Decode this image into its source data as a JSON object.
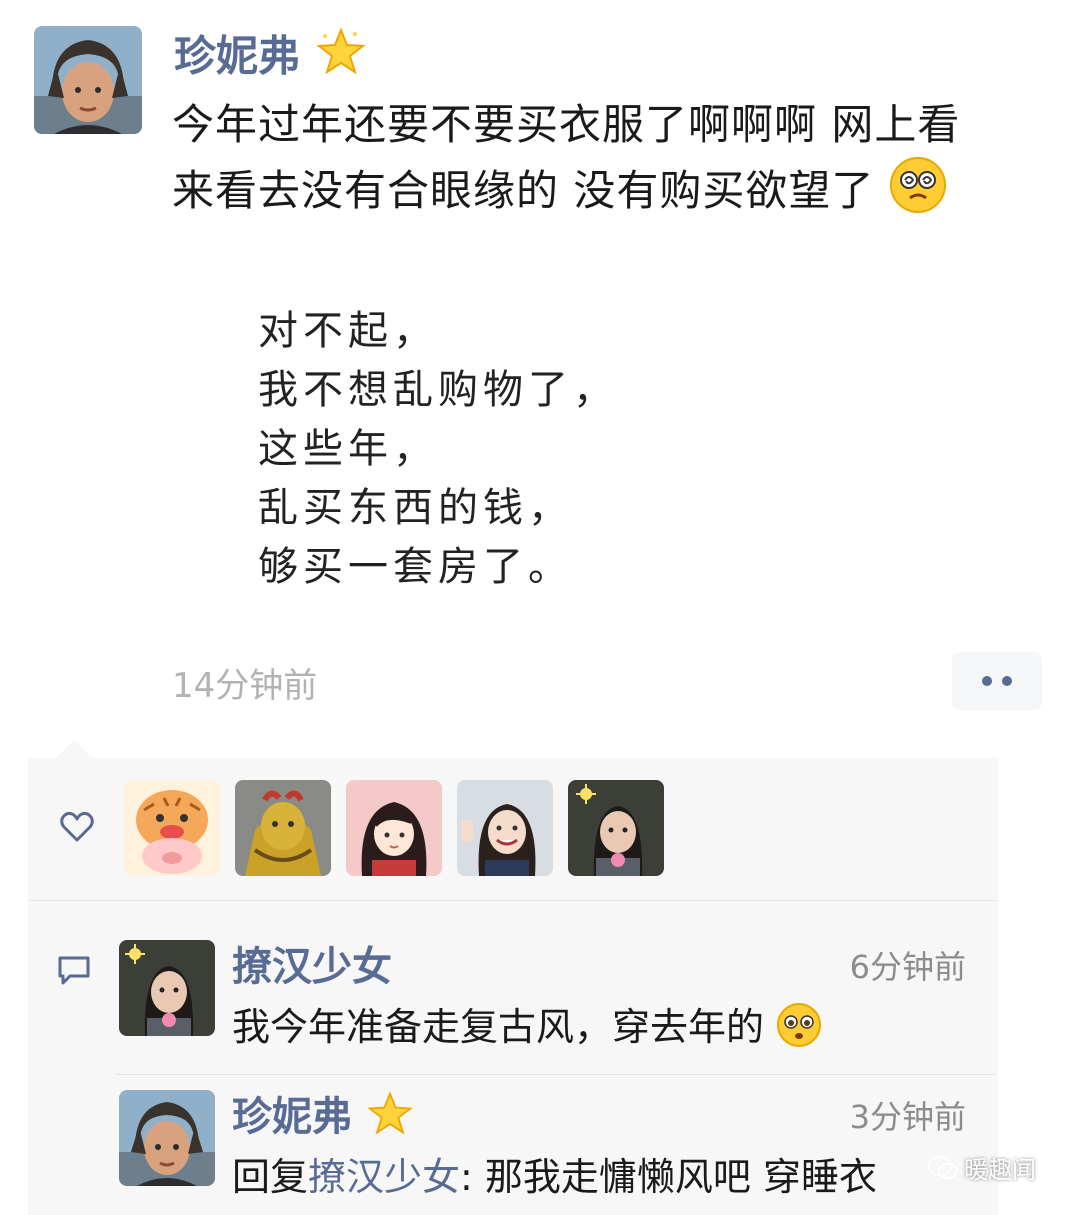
{
  "post": {
    "author": "珍妮弗",
    "text_line1": "今年过年还要不要买衣服了啊啊啊 网上看",
    "text_line2": "来看去没有合眼缘的 没有购买欲望了",
    "quote_lines": [
      "对不起，",
      "我不想乱购物了，",
      "这些年，",
      "乱买东西的钱，",
      "够买一套房了。"
    ],
    "time": "14分钟前"
  },
  "likes": {
    "icon": "heart-icon",
    "avatars": [
      "tiger-pig-avatar",
      "golden-lion-avatar",
      "cartoon-girl-avatar",
      "smiling-girl-avatar",
      "boy-flower-avatar"
    ]
  },
  "comments": [
    {
      "author": "撩汉少女",
      "time": "6分钟前",
      "text": "我今年准备走复古风，穿去年的"
    },
    {
      "author": "珍妮弗",
      "time": "3分钟前",
      "reply_prefix": "回复",
      "reply_to": "撩汉少女",
      "text": ": 那我走慵懒风吧 穿睡衣"
    }
  ],
  "watermark": "暖趣闻",
  "colors": {
    "name": "#576b95",
    "time": "#b2b2b2",
    "panel": "#f7f7f7"
  }
}
